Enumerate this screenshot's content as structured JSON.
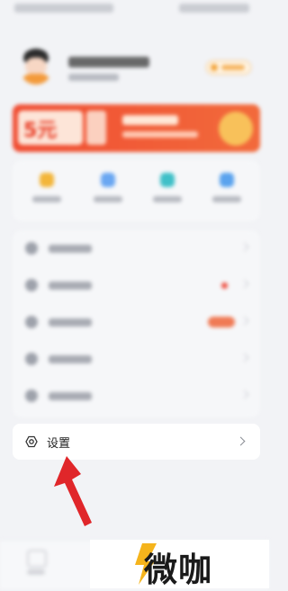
{
  "settings": {
    "label": "设置"
  },
  "watermark": {
    "text": "微咖"
  },
  "colors": {
    "banner_start": "#f04d33",
    "banner_end": "#f26a3b",
    "arrow": "#e0262a",
    "accent_orange": "#f2a43b"
  },
  "quick_actions": [
    {
      "icon": "gift-icon",
      "color": "#f3b63a"
    },
    {
      "icon": "person-icon",
      "color": "#6aa7f2"
    },
    {
      "icon": "home-icon",
      "color": "#3fc0c8"
    },
    {
      "icon": "cloud-icon",
      "color": "#5aa3ee"
    }
  ],
  "menu_rows": [
    {
      "icon": "document-icon",
      "badge": "none"
    },
    {
      "icon": "chat-icon",
      "badge": "red-dot"
    },
    {
      "icon": "wallet-icon",
      "badge": "pill"
    },
    {
      "icon": "info-icon",
      "badge": "none"
    },
    {
      "icon": "help-icon",
      "badge": "none"
    }
  ]
}
